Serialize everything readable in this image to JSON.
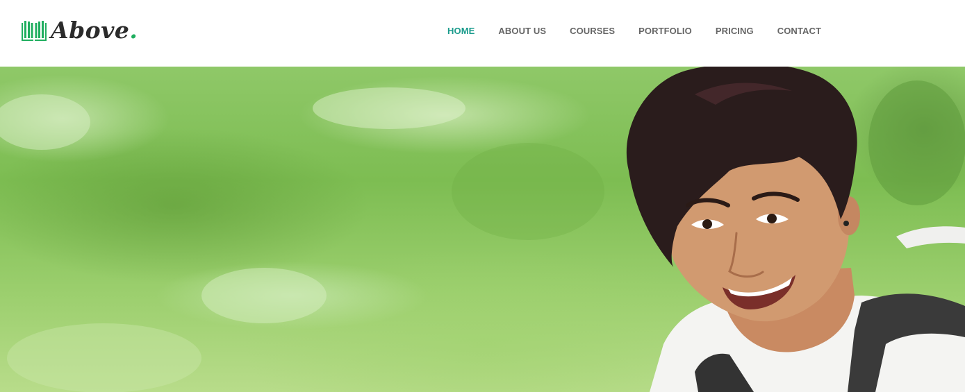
{
  "brand": {
    "name": "Above",
    "dot": ".",
    "accent_color": "#1fae5f",
    "icon": "open-book-icon"
  },
  "nav": {
    "active_color": "#1a9b8c",
    "items": [
      {
        "label": "HOME",
        "active": true
      },
      {
        "label": "ABOUT US",
        "active": false
      },
      {
        "label": "COURSES",
        "active": false
      },
      {
        "label": "PORTFOLIO",
        "active": false
      },
      {
        "label": "PRICING",
        "active": false
      },
      {
        "label": "CONTACT",
        "active": false
      }
    ]
  },
  "hero": {
    "image": "smiling-student-with-backpack-photo"
  }
}
